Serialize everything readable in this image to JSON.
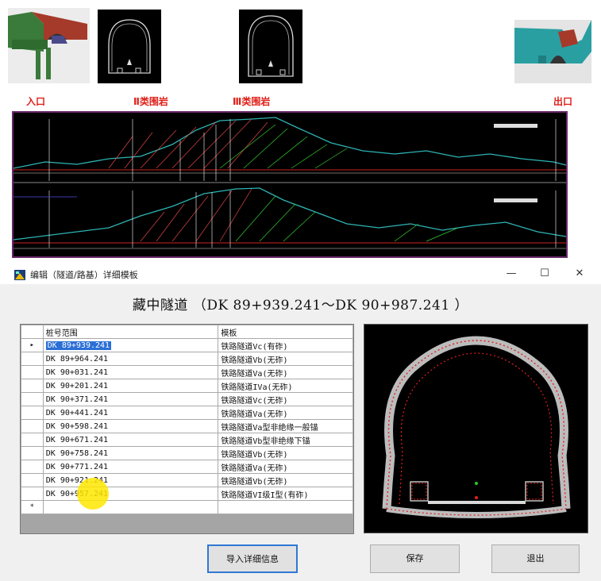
{
  "labels": {
    "entrance": "入口",
    "class2": "Ⅱ类围岩",
    "class3": "Ⅲ类围岩",
    "exit": "出口"
  },
  "window": {
    "title": "编辑（隧道/路基）详细模板",
    "minimize": "—",
    "maximize": "☐",
    "close": "✕"
  },
  "heading": "藏中隧道  （DK 89+939.241～DK 90+987.241  ）",
  "grid": {
    "columns": [
      "桩号范围",
      "模板"
    ],
    "rows": [
      {
        "station": "DK 89+939.241",
        "template": "铁路隧道Vc(有砟)",
        "selected": true
      },
      {
        "station": "DK 89+964.241",
        "template": "铁路隧道Vb(无砟)"
      },
      {
        "station": "DK 90+031.241",
        "template": "铁路隧道Va(无砟)"
      },
      {
        "station": "DK 90+201.241",
        "template": "铁路隧道IVa(无砟)"
      },
      {
        "station": "DK 90+371.241",
        "template": "铁路隧道Vc(无砟)"
      },
      {
        "station": "DK 90+441.241",
        "template": "铁路隧道Va(无砟)"
      },
      {
        "station": "DK 90+598.241",
        "template": "铁路隧道Va型非绝缘一般锚"
      },
      {
        "station": "DK 90+671.241",
        "template": "铁路隧道Vb型非绝缘下锚"
      },
      {
        "station": "DK 90+758.241",
        "template": "铁路隧道Vb(无砟)"
      },
      {
        "station": "DK 90+771.241",
        "template": "铁路隧道Va(无砟)"
      },
      {
        "station": "DK 90+921.241",
        "template": "铁路隧道Vb(无砟)"
      },
      {
        "station": "DK 90+957.241",
        "template": "铁路隧道VI级I型(有砟)"
      }
    ],
    "new_row_marker": "*",
    "current_row_marker": "▸"
  },
  "buttons": {
    "import": "导入详细信息",
    "save": "保存",
    "exit": "退出"
  },
  "colors": {
    "accent": "#2b6fd6",
    "label_red": "#e0201a",
    "preview_bg": "#000000",
    "lining_red": "#e02020"
  }
}
